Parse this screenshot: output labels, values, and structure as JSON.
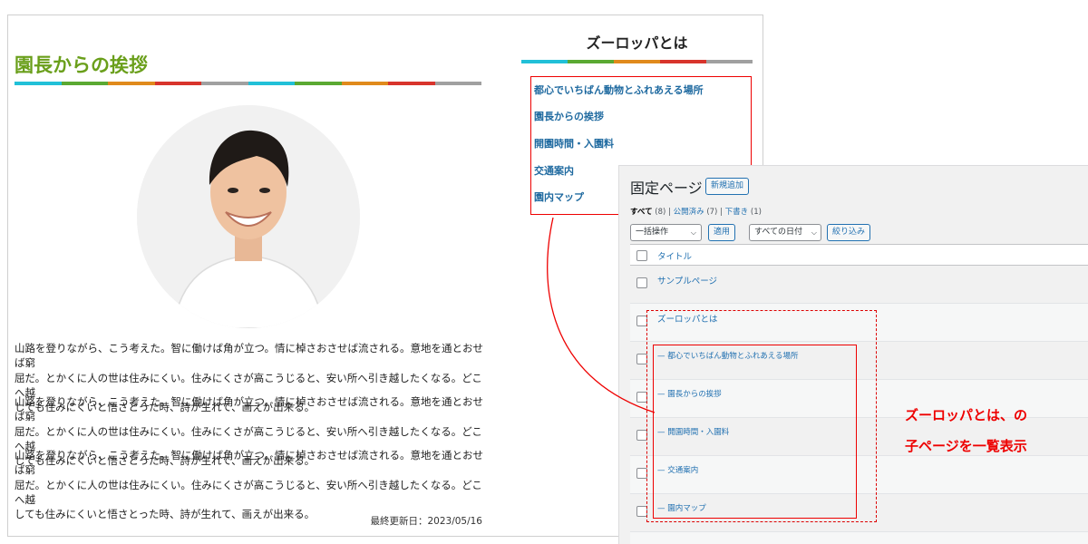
{
  "article": {
    "title": "園長からの挨拶",
    "paragraphs": [
      [
        "山路を登りながら、こう考えた。智に働けば角が立つ。情に棹さおさせば流される。意地を通とおせば窮",
        "屈だ。とかくに人の世は住みにくい。住みにくさが高こうじると、安い所へ引き越したくなる。どこへ越",
        "しても住みにくいと悟さとった時、詩が生れて、画えが出来る。"
      ],
      [
        "山路を登りながら、こう考えた。智に働けば角が立つ。情に棹さおさせば流される。意地を通とおせば窮",
        "屈だ。とかくに人の世は住みにくい。住みにくさが高こうじると、安い所へ引き越したくなる。どこへ越",
        "しても住みにくいと悟さとった時、詩が生れて、画えが出来る。"
      ],
      [
        "山路を登りながら、こう考えた。智に働けば角が立つ。情に棹さおさせば流される。意地を通とおせば窮",
        "屈だ。とかくに人の世は住みにくい。住みにくさが高こうじると、安い所へ引き越したくなる。どこへ越",
        "しても住みにくいと悟さとった時、詩が生れて、画えが出来る。"
      ]
    ],
    "updated": "最終更新日：2023/05/16"
  },
  "sidebar": {
    "title": "ズーロッパとは",
    "links": [
      "都心でいちばん動物とふれあえる場所",
      "園長からの挨拶",
      "開園時間・入園料",
      "交通案内",
      "園内マップ"
    ]
  },
  "admin": {
    "heading": "固定ページ",
    "add_new": "新規追加",
    "filters": {
      "all": "すべて",
      "all_count": "(8)",
      "sep": "|",
      "published": "公開済み",
      "published_count": "(7)",
      "draft": "下書き",
      "draft_count": "(1)"
    },
    "bulk_action": "一括操作",
    "apply": "適用",
    "date_filter": "すべての日付",
    "filter_btn": "絞り込み",
    "column_title": "タイトル",
    "rows": [
      "サンプルページ",
      "ズーロッパとは",
      "— 都心でいちばん動物とふれあえる場所",
      "— 園長からの挨拶",
      "— 開園時間・入園料",
      "— 交通案内",
      "— 園内マップ"
    ]
  },
  "annotation": {
    "line1": "ズーロッパとは、の",
    "line2": "子ページを一覧表示"
  },
  "colors": {
    "title_green": "#6a9f1b",
    "stripe": [
      "#21c0d8",
      "#5aa932",
      "#e08a1c",
      "#d8342c",
      "#a0a0a0"
    ],
    "highlight_red": "#ee0000",
    "wp_link": "#2271b1"
  }
}
